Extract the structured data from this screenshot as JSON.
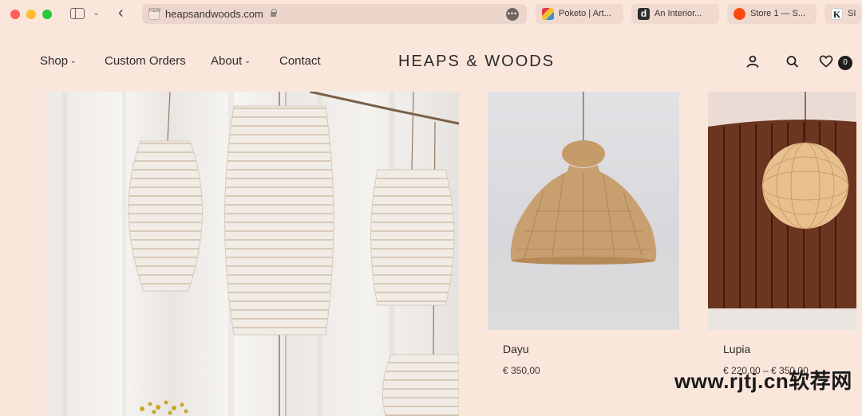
{
  "browser": {
    "url": "heapsandwoods.com",
    "favicon_text": "H&W",
    "tabs": [
      {
        "label": "Poketo | Art...",
        "icon": "poketo-favicon"
      },
      {
        "label": "An Interior...",
        "icon": "d-favicon"
      },
      {
        "label": "Store 1 — S...",
        "icon": "store-favicon"
      },
      {
        "label": "SI",
        "icon": "k-favicon",
        "letter": "K"
      }
    ]
  },
  "header": {
    "nav": {
      "shop": "Shop",
      "custom_orders": "Custom Orders",
      "about": "About",
      "contact": "Contact"
    },
    "logo": "HEAPS & WOODS",
    "cart_count": "0"
  },
  "products": [
    {
      "name": "Dayu",
      "price": "€ 350,00"
    },
    {
      "name": "Lupia",
      "price": "€ 220,00 – € 350,00"
    }
  ],
  "watermark": "www.rjtj.cn软荐网",
  "colors": {
    "page_bg": "#fbe6dc",
    "address_bar": "#ecd6cc",
    "text": "#2b2b2b"
  }
}
